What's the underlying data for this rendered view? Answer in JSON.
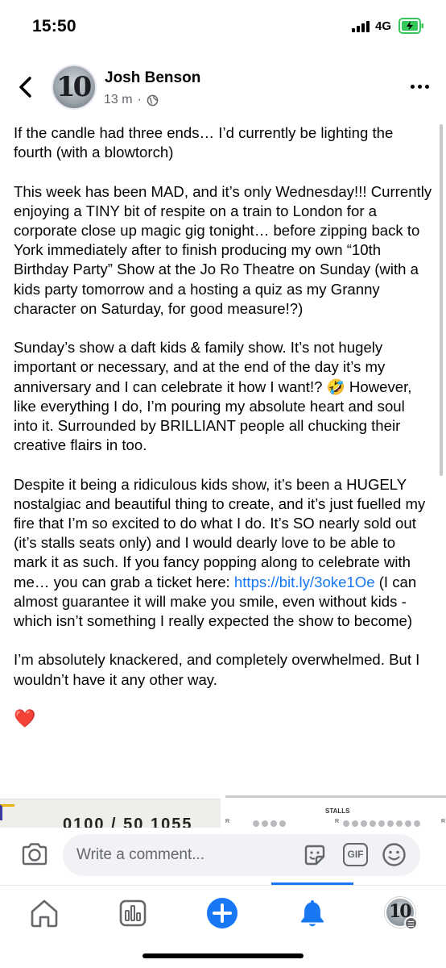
{
  "status_bar": {
    "time": "15:50",
    "network": "4G",
    "battery_level": 0.5,
    "battery_color": "#34c759"
  },
  "post": {
    "author": "Josh Benson",
    "timestamp": "13 m",
    "separator": "·",
    "privacy_icon": "globe-icon",
    "paragraphs": [
      "If the candle had three ends… I’d currently be lighting the fourth (with a blowtorch)",
      "This week has been MAD, and it’s only Wednesday!!! Currently enjoying a TINY bit of respite on a train to London for a corporate close up magic gig tonight… before zipping back to York immediately after to finish producing my own “10th Birthday Party” Show at the Jo Ro Theatre on Sunday (with a kids party tomorrow and a hosting a quiz as my Granny character on Saturday, for good measure!?)",
      "Sunday’s show a daft kids & family show. It’s not hugely important or necessary, and at the end of the day it’s my anniversary and I can celebrate it how I want!? 🤣 However, like everything I do, I’m pouring my absolute heart and soul into it. Surrounded by BRILLIANT people all chucking their creative flairs in too."
    ],
    "paragraph4_before_link": "Despite it being a ridiculous kids show, it’s been a HUGELY nostalgiac and beautiful thing to create, and it’s just fuelled my fire that I’m so excited to do what I do. It’s SO nearly sold out (it’s stalls seats only) and I would dearly love to be able to mark it as such. If you fancy popping along to celebrate with me… you can grab a ticket here: ",
    "link_text": "https://bit.ly/3oke1Oe",
    "paragraph4_after_link": " (I can almost guarantee it will make you smile, even without kids - which isn’t something I really expected the show to become)",
    "paragraph5": "I’m absolutely knackered, and completely overwhelmed. But I wouldn’t have it any other way.",
    "heart": "❤️",
    "link_color": "#1877f2"
  },
  "media": {
    "left_partial_text": "0100 / 50 1055",
    "right_stalls_label": "STALLS",
    "row_label": "R"
  },
  "comment_bar": {
    "placeholder": "Write a comment...",
    "gif_label": "GIF"
  },
  "bottom_nav": {
    "items": [
      "home-icon",
      "feeds-icon",
      "create-icon",
      "notifications-icon",
      "menu-profile"
    ],
    "active_color": "#1877f2"
  }
}
